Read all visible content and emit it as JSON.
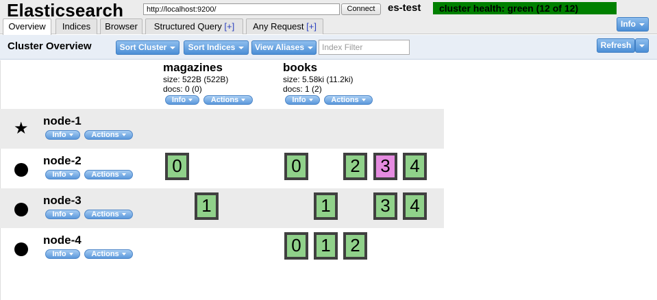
{
  "header": {
    "title": "Elasticsearch",
    "url_value": "http://localhost:9200/",
    "connect_label": "Connect",
    "cluster_name": "es-test",
    "health_text": "cluster health: green (12 of 12)",
    "health_color": "#008000",
    "info_label": "Info"
  },
  "tabs": [
    {
      "label": "Overview",
      "plus": ""
    },
    {
      "label": "Indices",
      "plus": ""
    },
    {
      "label": "Browser",
      "plus": ""
    },
    {
      "label": "Structured Query ",
      "plus": "[+]"
    },
    {
      "label": "Any Request ",
      "plus": "[+]"
    }
  ],
  "toolbar": {
    "title": "Cluster Overview",
    "sort_cluster": "Sort Cluster",
    "sort_indices": "Sort Indices",
    "view_aliases": "View Aliases",
    "index_filter_placeholder": "Index Filter",
    "refresh": "Refresh"
  },
  "indices": [
    {
      "name": "magazines",
      "size": "size: 522B (522B)",
      "docs": "docs: 0 (0)",
      "info": "Info",
      "actions": "Actions"
    },
    {
      "name": "books",
      "size": "size: 5.58ki (11.2ki)",
      "docs": "docs: 1 (2)",
      "info": "Info",
      "actions": "Actions"
    }
  ],
  "nodes": [
    {
      "name": "node-1",
      "master": true,
      "info": "Info",
      "actions": "Actions",
      "magazines_shards": [],
      "books_shards": []
    },
    {
      "name": "node-2",
      "master": false,
      "info": "Info",
      "actions": "Actions",
      "magazines_shards": [
        "0"
      ],
      "books_shards": [
        "0",
        "2",
        "3",
        "4"
      ]
    },
    {
      "name": "node-3",
      "master": false,
      "info": "Info",
      "actions": "Actions",
      "magazines_shards": [
        "1"
      ],
      "books_shards": [
        "1",
        "3",
        "4"
      ]
    },
    {
      "name": "node-4",
      "master": false,
      "info": "Info",
      "actions": "Actions",
      "magazines_shards": [],
      "books_shards": [
        "0",
        "1",
        "2"
      ]
    }
  ],
  "colors": {
    "shard_green": "#90d18a",
    "shard_relocating": "#e58be0",
    "button_blue": "#4b8ed6"
  },
  "icons": {
    "master": "star-icon",
    "node": "circle-icon",
    "dropdown": "caret-down-icon"
  }
}
